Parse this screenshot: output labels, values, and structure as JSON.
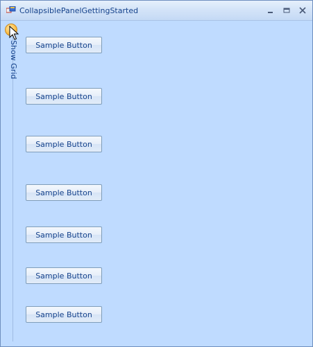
{
  "window": {
    "title": "CollapsiblePanelGettingStarted",
    "controls": {
      "minimize_icon": "minimize-icon",
      "maximize_icon": "maximize-icon",
      "close_icon": "close-icon"
    }
  },
  "panel": {
    "header_label": "Show Grid",
    "toggle_icon": "expand-chevron-icon",
    "accent_color": "#ffc04a"
  },
  "buttons": [
    {
      "label": "Sample Button"
    },
    {
      "label": "Sample Button"
    },
    {
      "label": "Sample Button"
    },
    {
      "label": "Sample Button"
    },
    {
      "label": "Sample Button"
    },
    {
      "label": "Sample Button"
    },
    {
      "label": "Sample Button"
    }
  ],
  "colors": {
    "background": "#bfdbff",
    "text": "#15428b"
  }
}
